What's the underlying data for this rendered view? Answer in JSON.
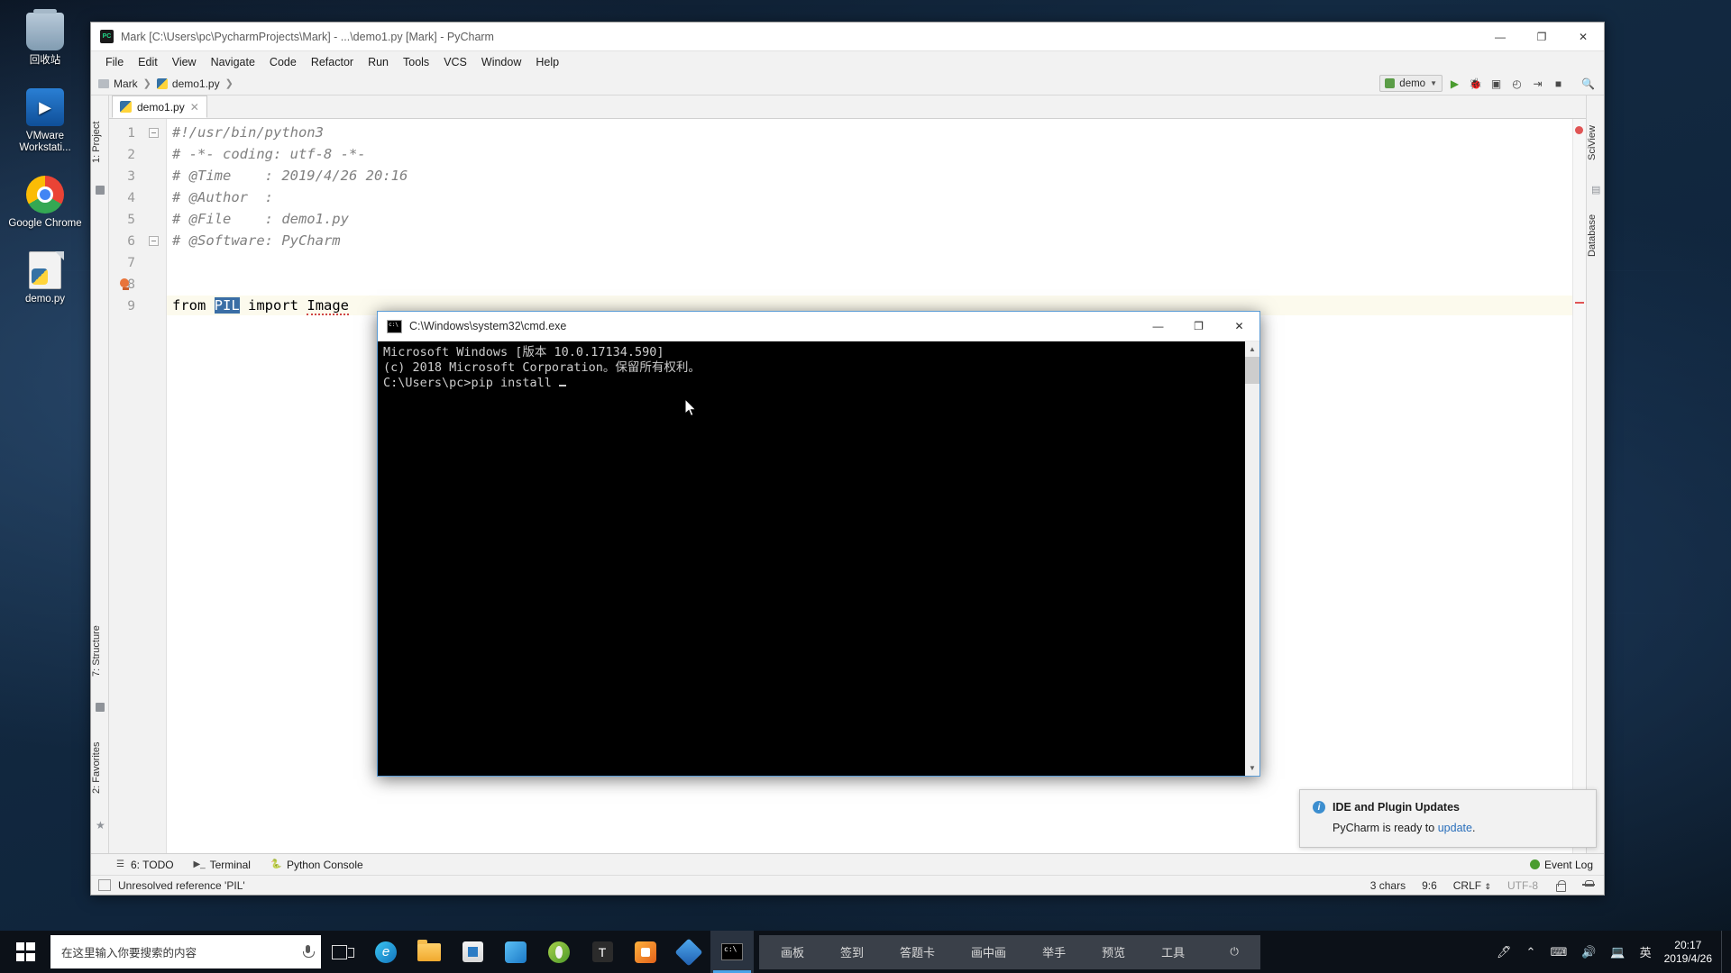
{
  "desktop": {
    "icons": [
      {
        "label": "回收站",
        "icon": "recycle-bin-icon"
      },
      {
        "label": "VMware Workstati...",
        "icon": "vmware-icon"
      },
      {
        "label": "Google Chrome",
        "icon": "chrome-icon"
      },
      {
        "label": "demo.py",
        "icon": "python-file-icon"
      }
    ]
  },
  "pycharm": {
    "title": "Mark [C:\\Users\\pc\\PycharmProjects\\Mark] - ...\\demo1.py [Mark] - PyCharm",
    "window_controls": {
      "minimize": "—",
      "maximize": "❐",
      "close": "✕"
    },
    "menus": [
      "File",
      "Edit",
      "View",
      "Navigate",
      "Code",
      "Refactor",
      "Run",
      "Tools",
      "VCS",
      "Window",
      "Help"
    ],
    "breadcrumb": [
      "Mark",
      "demo1.py"
    ],
    "run_config": "demo",
    "tabs": [
      {
        "label": "demo1.py"
      }
    ],
    "code_lines": [
      {
        "num": 1,
        "text": "#!/usr/bin/python3"
      },
      {
        "num": 2,
        "text": "# -*- coding: utf-8 -*-"
      },
      {
        "num": 3,
        "text": "# @Time    : 2019/4/26 20:16"
      },
      {
        "num": 4,
        "text": "# @Author  :"
      },
      {
        "num": 5,
        "text": "# @File    : demo1.py"
      },
      {
        "num": 6,
        "text": "# @Software: PyCharm"
      },
      {
        "num": 7,
        "text": ""
      },
      {
        "num": 8,
        "text": ""
      },
      {
        "num": 9,
        "text": "from PIL import Image"
      }
    ],
    "code_line9": {
      "kw_from": "from",
      "module": "PIL",
      "kw_import": "import",
      "name": "Image"
    },
    "left_strips": [
      {
        "label": "1: Project"
      },
      {
        "label": "7: Structure"
      },
      {
        "label": "2: Favorites"
      }
    ],
    "right_strips": [
      {
        "label": "SciView"
      },
      {
        "label": "Database"
      }
    ],
    "bottom_tools": [
      {
        "label": "6: TODO",
        "icon": "list-icon"
      },
      {
        "label": "Terminal",
        "icon": "terminal-icon"
      },
      {
        "label": "Python Console",
        "icon": "python-icon"
      }
    ],
    "event_log": "Event Log",
    "status": {
      "message": "Unresolved reference 'PIL'",
      "chars": "3 chars",
      "caret": "9:6",
      "line_sep": "CRLF",
      "encoding": "UTF-8"
    },
    "notification": {
      "title": "IDE and Plugin Updates",
      "body_prefix": "PyCharm is ready to ",
      "link": "update",
      "body_suffix": "."
    }
  },
  "cmd": {
    "title": "C:\\Windows\\system32\\cmd.exe",
    "window_controls": {
      "minimize": "—",
      "maximize": "❐",
      "close": "✕"
    },
    "lines": [
      "Microsoft Windows [版本 10.0.17134.590]",
      "(c) 2018 Microsoft Corporation。保留所有权利。",
      "",
      "C:\\Users\\pc>pip install "
    ]
  },
  "taskbar": {
    "search_placeholder": "在这里输入你要搜索的内容",
    "pinned": [
      {
        "name": "task-view-icon"
      },
      {
        "name": "edge-icon"
      },
      {
        "name": "file-explorer-icon"
      },
      {
        "name": "store-icon"
      },
      {
        "name": "blue-app-icon"
      },
      {
        "name": "green-app-icon"
      },
      {
        "name": "text-app-icon"
      },
      {
        "name": "orange-app-icon"
      },
      {
        "name": "diamond-app-icon"
      },
      {
        "name": "cmd-icon"
      }
    ],
    "toolbar_items": [
      "画板",
      "签到",
      "答题卡",
      "画中画",
      "举手",
      "预览",
      "工具"
    ],
    "tray": [
      "⌃",
      "⌨",
      "🔊",
      "💻",
      "英"
    ],
    "clock": {
      "time": "20:17",
      "date": "2019/4/26"
    }
  }
}
